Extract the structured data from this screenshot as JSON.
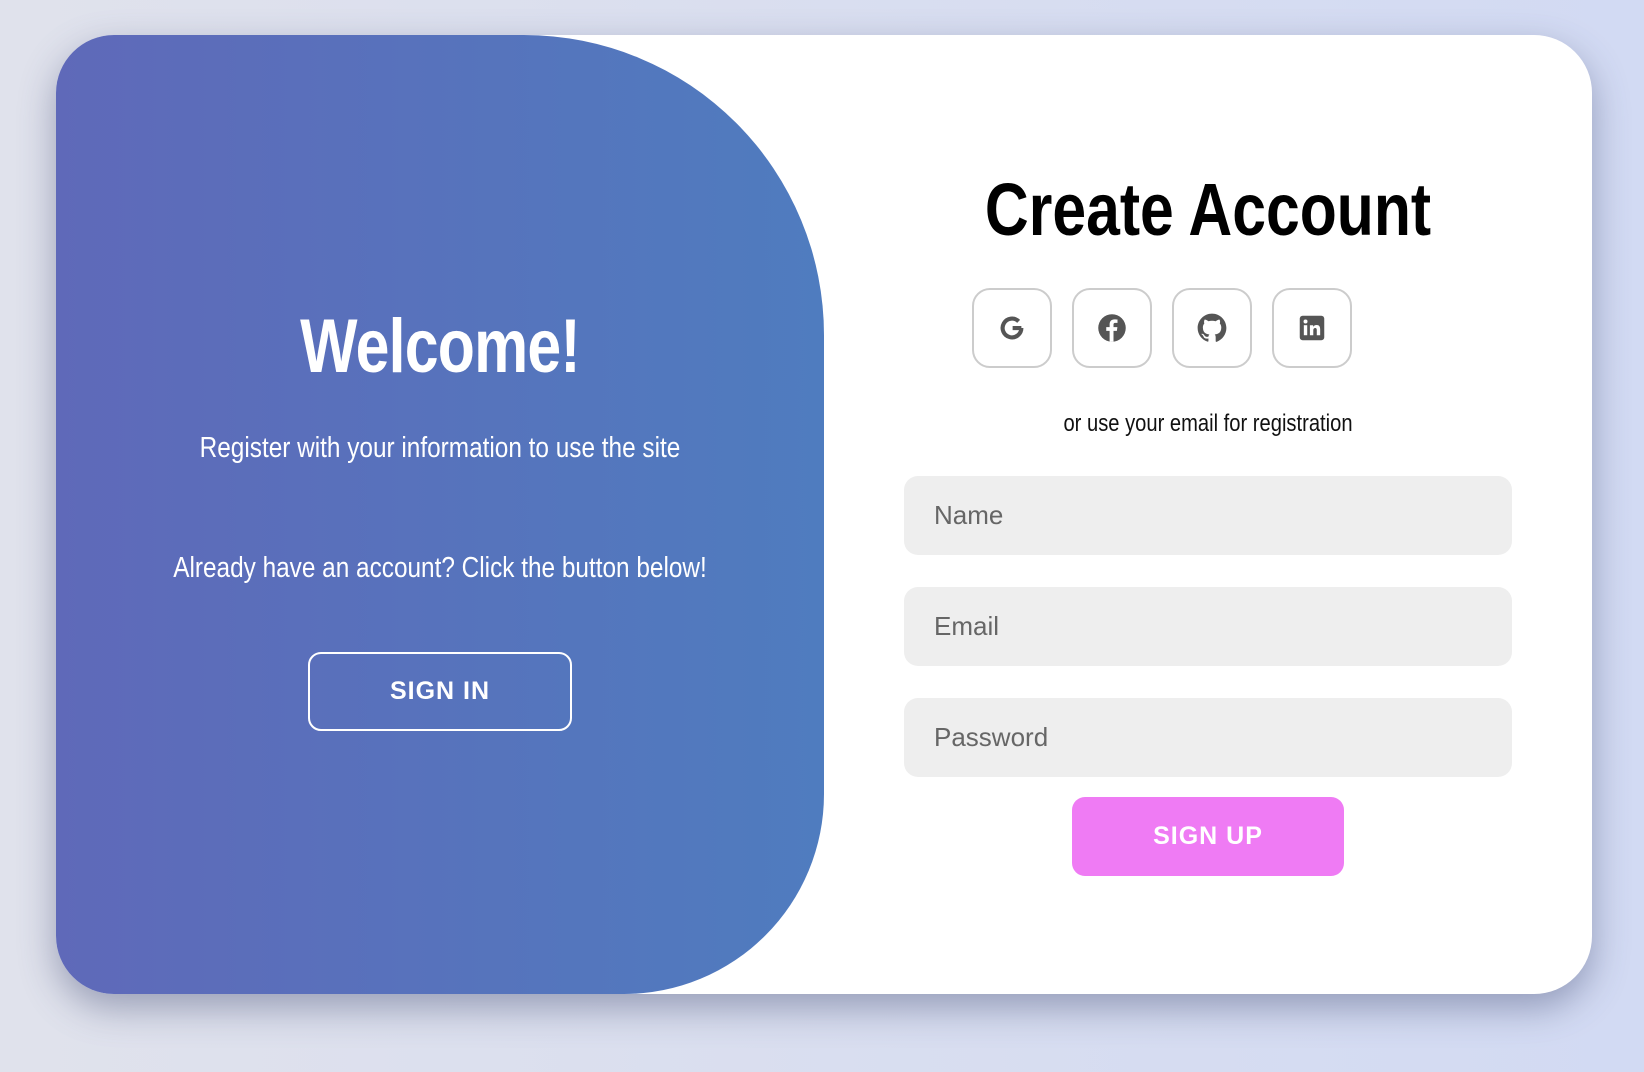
{
  "welcome_panel": {
    "title": "Welcome!",
    "subtitle": "Register with your information to use the site",
    "prompt": "Already have an account? Click the button below!",
    "sign_in_label": "SIGN IN"
  },
  "form": {
    "title": "Create Account",
    "social_buttons": [
      {
        "icon": "google-icon"
      },
      {
        "icon": "facebook-icon"
      },
      {
        "icon": "github-icon"
      },
      {
        "icon": "linkedin-icon"
      }
    ],
    "hint": "or use your email for registration",
    "name_placeholder": "Name",
    "email_placeholder": "Email",
    "password_placeholder": "Password",
    "sign_up_label": "SIGN UP"
  },
  "colors": {
    "panel_gradient_start": "#5f69b9",
    "panel_gradient_end": "#4f7cbf",
    "sign_up_button": "#ef7bf4",
    "input_background": "#eeeeee",
    "icon_color": "#555555"
  }
}
